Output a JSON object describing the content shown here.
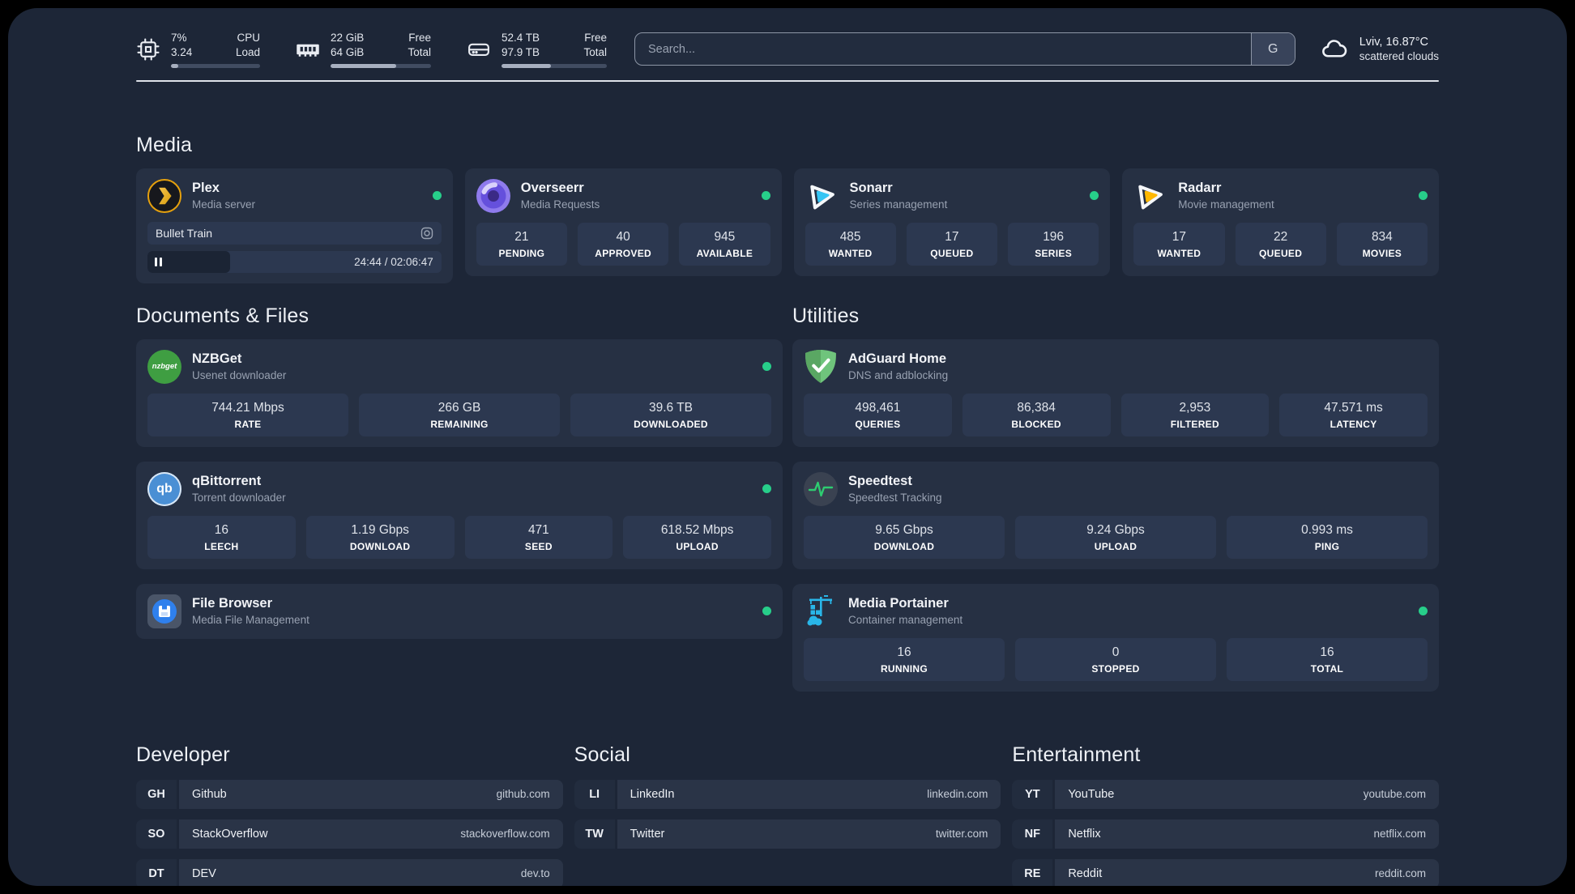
{
  "topbar": {
    "resources": [
      {
        "icon": "cpu-icon",
        "left": [
          "7%",
          "3.24"
        ],
        "right": [
          "CPU",
          "Load"
        ],
        "progress": 8
      },
      {
        "icon": "memory-icon",
        "left": [
          "22 GiB",
          "64 GiB"
        ],
        "right": [
          "Free",
          "Total"
        ],
        "progress": 65
      },
      {
        "icon": "disk-icon",
        "left": [
          "52.4 TB",
          "97.9 TB"
        ],
        "right": [
          "Free",
          "Total"
        ],
        "progress": 47
      }
    ],
    "search": {
      "placeholder": "Search...",
      "button_label": "G"
    },
    "weather": {
      "location_temp": "Lviv, 16.87°C",
      "condition": "scattered clouds"
    }
  },
  "media": {
    "title": "Media",
    "cards": [
      {
        "title": "Plex",
        "subtitle": "Media server",
        "now_playing": "Bullet Train",
        "time": "24:44 / 02:06:47",
        "progress_pct": 28
      },
      {
        "title": "Overseerr",
        "subtitle": "Media Requests",
        "stats": [
          {
            "value": "21",
            "label": "PENDING"
          },
          {
            "value": "40",
            "label": "APPROVED"
          },
          {
            "value": "945",
            "label": "AVAILABLE"
          }
        ]
      },
      {
        "title": "Sonarr",
        "subtitle": "Series management",
        "stats": [
          {
            "value": "485",
            "label": "WANTED"
          },
          {
            "value": "17",
            "label": "QUEUED"
          },
          {
            "value": "196",
            "label": "SERIES"
          }
        ]
      },
      {
        "title": "Radarr",
        "subtitle": "Movie management",
        "stats": [
          {
            "value": "17",
            "label": "WANTED"
          },
          {
            "value": "22",
            "label": "QUEUED"
          },
          {
            "value": "834",
            "label": "MOVIES"
          }
        ]
      }
    ]
  },
  "documents": {
    "title": "Documents & Files",
    "cards": [
      {
        "title": "NZBGet",
        "subtitle": "Usenet downloader",
        "icon_text": "nzbget",
        "stats": [
          {
            "value": "744.21 Mbps",
            "label": "RATE"
          },
          {
            "value": "266 GB",
            "label": "REMAINING"
          },
          {
            "value": "39.6 TB",
            "label": "DOWNLOADED"
          }
        ]
      },
      {
        "title": "qBittorrent",
        "subtitle": "Torrent downloader",
        "icon_text": "qb",
        "stats": [
          {
            "value": "16",
            "label": "LEECH"
          },
          {
            "value": "1.19 Gbps",
            "label": "DOWNLOAD"
          },
          {
            "value": "471",
            "label": "SEED"
          },
          {
            "value": "618.52 Mbps",
            "label": "UPLOAD"
          }
        ]
      },
      {
        "title": "File Browser",
        "subtitle": "Media File Management"
      }
    ]
  },
  "utilities": {
    "title": "Utilities",
    "cards": [
      {
        "title": "AdGuard Home",
        "subtitle": "DNS and adblocking",
        "stats": [
          {
            "value": "498,461",
            "label": "QUERIES"
          },
          {
            "value": "86,384",
            "label": "BLOCKED"
          },
          {
            "value": "2,953",
            "label": "FILTERED"
          },
          {
            "value": "47.571 ms",
            "label": "LATENCY"
          }
        ]
      },
      {
        "title": "Speedtest",
        "subtitle": "Speedtest Tracking",
        "stats": [
          {
            "value": "9.65 Gbps",
            "label": "DOWNLOAD"
          },
          {
            "value": "9.24 Gbps",
            "label": "UPLOAD"
          },
          {
            "value": "0.993 ms",
            "label": "PING"
          }
        ]
      },
      {
        "title": "Media Portainer",
        "subtitle": "Container management",
        "stats": [
          {
            "value": "16",
            "label": "RUNNING"
          },
          {
            "value": "0",
            "label": "STOPPED"
          },
          {
            "value": "16",
            "label": "TOTAL"
          }
        ]
      }
    ]
  },
  "bookmarks": [
    {
      "title": "Developer",
      "links": [
        {
          "abbr": "GH",
          "name": "Github",
          "url": "github.com"
        },
        {
          "abbr": "SO",
          "name": "StackOverflow",
          "url": "stackoverflow.com"
        },
        {
          "abbr": "DT",
          "name": "DEV",
          "url": "dev.to"
        }
      ]
    },
    {
      "title": "Social",
      "links": [
        {
          "abbr": "LI",
          "name": "LinkedIn",
          "url": "linkedin.com"
        },
        {
          "abbr": "TW",
          "name": "Twitter",
          "url": "twitter.com"
        }
      ]
    },
    {
      "title": "Entertainment",
      "links": [
        {
          "abbr": "YT",
          "name": "YouTube",
          "url": "youtube.com"
        },
        {
          "abbr": "NF",
          "name": "Netflix",
          "url": "netflix.com"
        },
        {
          "abbr": "RE",
          "name": "Reddit",
          "url": "reddit.com"
        }
      ]
    }
  ],
  "colors": {
    "status_ok": "#27ce8a",
    "plex_accent": "#e5a00d",
    "overseerr_purple": "#6550dc",
    "sonarr_blue": "#35c5f4",
    "radarr_yellow": "#ffb800",
    "nzbget_green": "#3f9e42",
    "qbittorrent_blue": "#4a8fd4",
    "filebrowser_blue": "#2f80ed",
    "adguard_green": "#68b974",
    "speedtest_green": "#2ecc71",
    "portainer_blue": "#29b6e8"
  }
}
